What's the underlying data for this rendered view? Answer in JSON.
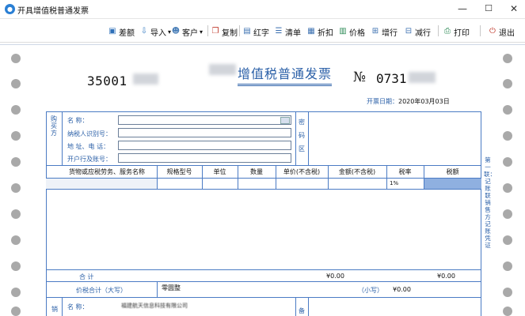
{
  "window": {
    "title": "开具增值税普通发票",
    "min": "—",
    "max": "☐",
    "close": "✕"
  },
  "toolbar": {
    "items": [
      {
        "label": "差额",
        "icon": "diff-icon"
      },
      {
        "label": "导入",
        "icon": "import-icon",
        "dropdown": "▾"
      },
      {
        "label": "客户",
        "icon": "customer-icon",
        "dropdown": "▾"
      },
      {
        "label": "复制",
        "icon": "copy-icon"
      },
      {
        "label": "红字",
        "icon": "red-invoice-icon"
      },
      {
        "label": "清单",
        "icon": "list-icon"
      },
      {
        "label": "折扣",
        "icon": "discount-icon"
      },
      {
        "label": "价格",
        "icon": "price-icon"
      },
      {
        "label": "增行",
        "icon": "add-row-icon"
      },
      {
        "label": "减行",
        "icon": "remove-row-icon"
      },
      {
        "label": "打印",
        "icon": "print-icon"
      },
      {
        "label": "退出",
        "icon": "exit-icon"
      }
    ]
  },
  "invoice": {
    "code": "35001",
    "title": "增值税普通发票",
    "no_sign": "№",
    "number": "0731",
    "issue_date_label": "开票日期：",
    "issue_date": "2020年03月03日",
    "buyer": {
      "side_label": "购买方",
      "fields": [
        "名      称：",
        "纳税人识别号：",
        "地  址、电  话：",
        "开户行及账号："
      ]
    },
    "password_area": "密码区",
    "columns": [
      "货物或应税劳务、服务名称",
      "规格型号",
      "单位",
      "数量",
      "单价(不含税)",
      "金额(不含税)",
      "税率",
      "税额"
    ],
    "row1_tax_rate": "1%",
    "total_label": "合        计",
    "total_amount": "¥0.00",
    "total_tax": "¥0.00",
    "grand_total_label": "价税合计（大写）",
    "grand_total_caps": "零圆整",
    "small_label": "（小写）",
    "small_amount": "¥0.00",
    "seller": {
      "side_label": "销",
      "name_label": "名      称：",
      "name_value": "福建航天信息科技有限公司",
      "remark_label": "备"
    },
    "right_side": "第一联：记账联 销售方记账凭证"
  }
}
